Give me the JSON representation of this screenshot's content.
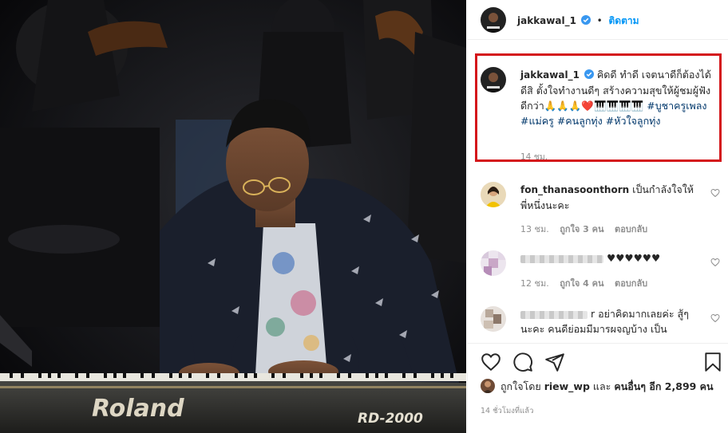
{
  "post": {
    "username": "jakkawal_1",
    "follow_label": "ติดตาม",
    "dot": "•"
  },
  "caption": {
    "username": "jakkawal_1",
    "text": "คิดดี ทำดี เจตนาดีก็ต้องได้ดีสิ ตั้งใจทำงานดีๆ สร้างความสุขให้ผู้ชมผู้ฟังดีกว่า🙏🙏🙏❤️🎹🎹🎹🎹",
    "hashtags": "#บูชาครูเพลง #แม่ครู #คนลูกทุ่ง #หัวใจลูกทุ่ง",
    "time": "14 ชม."
  },
  "comments": [
    {
      "username": "fon_thanasoonthorn",
      "text": "เป็นกำลังใจให้พี่หนึ่งนะคะ",
      "time": "13 ชม.",
      "likes": "ถูกใจ 3 คน",
      "reply": "ตอบกลับ"
    },
    {
      "username": "",
      "text": "♥♥♥♥♥♥",
      "time": "12 ชม.",
      "likes": "ถูกใจ 4 คน",
      "reply": "ตอบกลับ"
    },
    {
      "username": "",
      "text": "r อย่าคิดมากเลยค่ะ สู้ๆนะคะ คนดีย่อมมีมารผจญบ้าง เป็น"
    }
  ],
  "likes": {
    "prefix": "ถูกใจโดย",
    "user": "riew_wp",
    "and": "และ",
    "others": "คนอื่นๆ อีก 2,899 คน"
  },
  "posted_ago": "14 ชั่วโมงที่แล้ว",
  "photo": {
    "brand_text": "Roland",
    "model_text": "RD-2000"
  },
  "colors": {
    "accent": "#0095f6",
    "highlight_border": "#d4161b",
    "hashtag": "#00376b",
    "muted": "#8e8e8e",
    "like_red": "#ed4956"
  },
  "icons": [
    "verified-badge-icon",
    "heart-icon",
    "comment-icon",
    "share-icon",
    "bookmark-icon"
  ]
}
